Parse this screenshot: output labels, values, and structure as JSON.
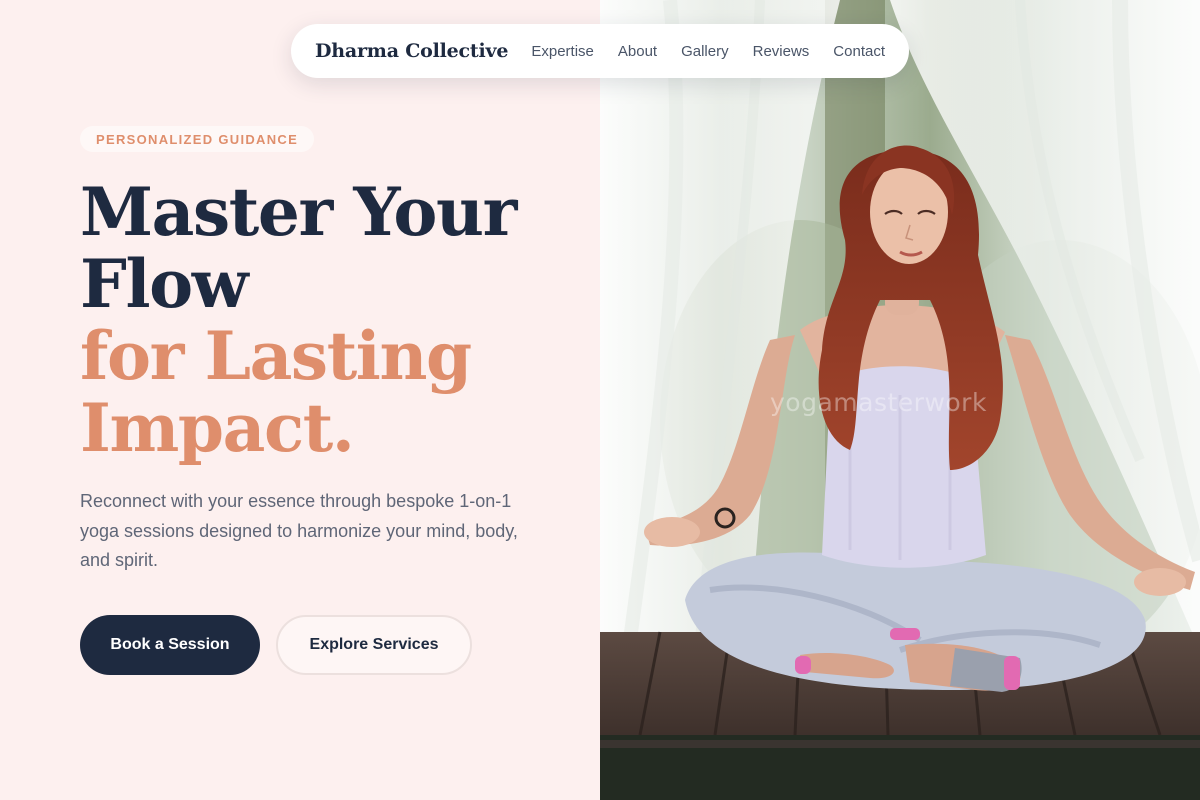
{
  "brand": {
    "name": "Dharma Collective"
  },
  "nav": {
    "links": [
      "Expertise",
      "About",
      "Gallery",
      "Reviews",
      "Contact"
    ]
  },
  "hero": {
    "eyebrow": "PERSONALIZED GUIDANCE",
    "headline_dark": [
      "Master Your",
      "Flow"
    ],
    "headline_accent": [
      "for Lasting",
      "Impact."
    ],
    "subtext": "Reconnect with your essence through bespoke 1-on-1 yoga sessions designed to harmonize your mind, body, and spirit.",
    "primary_cta": "Book a Session",
    "secondary_cta": "Explore Services"
  },
  "image": {
    "watermark": "yogamasterwork"
  },
  "colors": {
    "navy": "#1e2a40",
    "accent": "#df8e6c",
    "background": "#fdf0ef",
    "text_muted": "#5f6677"
  }
}
